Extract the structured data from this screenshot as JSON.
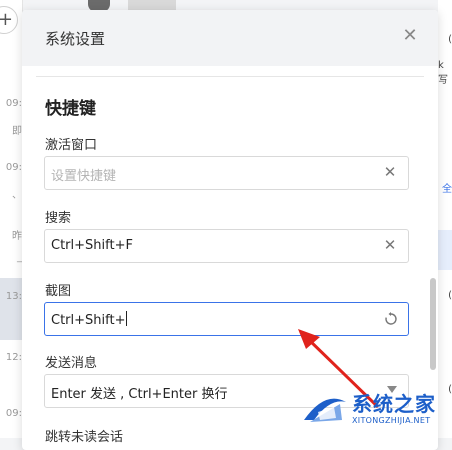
{
  "background": {
    "left_rows": [
      "09:",
      "即",
      "09:",
      "、",
      "昨",
      "_",
      "13:",
      "12:",
      "09:"
    ],
    "right_segments": [
      "(",
      "k写",
      "全",
      "(",
      "("
    ]
  },
  "dialog": {
    "title": "系统设置",
    "close_icon": "close-icon",
    "section_title": "快捷键",
    "fields": [
      {
        "label": "激活窗口",
        "value": "",
        "placeholder": "设置快捷键",
        "icon": "clear-icon"
      },
      {
        "label": "搜索",
        "value": "Ctrl+Shift+F",
        "placeholder": "",
        "icon": "clear-icon"
      },
      {
        "label": "截图",
        "value": "Ctrl+Shift+",
        "placeholder": "",
        "icon": "reset-icon"
      },
      {
        "label": "发送消息",
        "value": "Enter 发送 , Ctrl+Enter 换行",
        "placeholder": "",
        "icon": "chevron-down-icon"
      },
      {
        "label": "跳转未读会话",
        "value": "",
        "placeholder": "",
        "icon": ""
      }
    ]
  },
  "watermark": {
    "text": "系统之家",
    "sub": "XITONGZHIJIA.NET"
  },
  "colors": {
    "accent": "#3a73e8",
    "arrow": "#e0231c",
    "watermark": "#1d5fc9"
  }
}
